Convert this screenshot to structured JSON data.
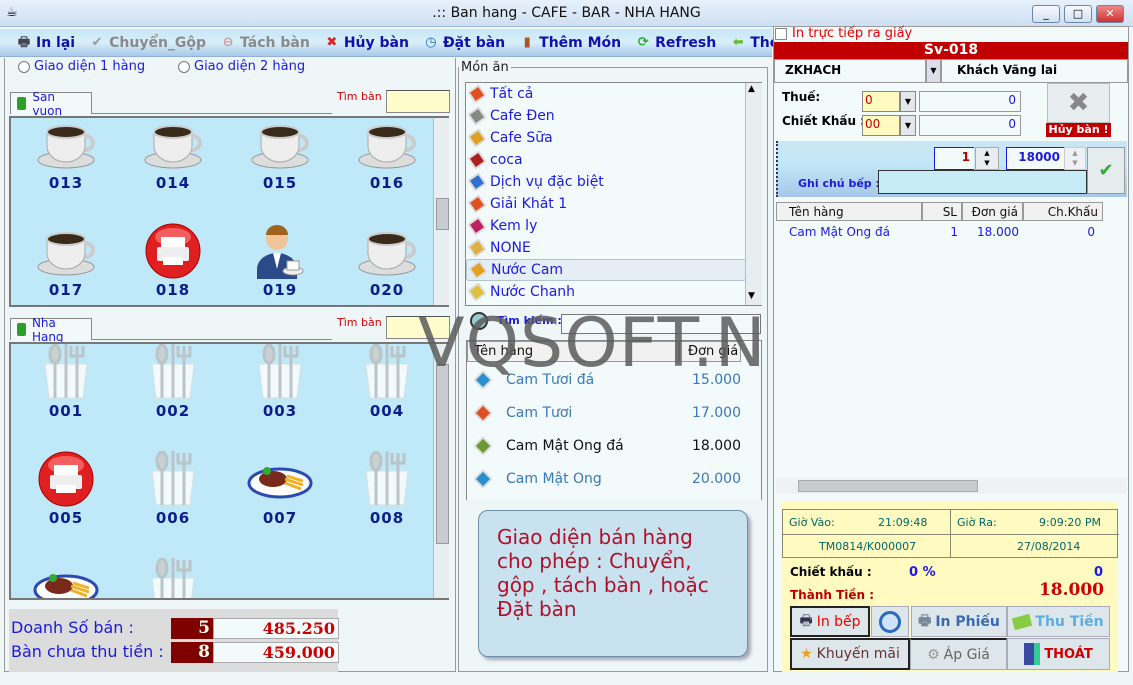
{
  "window": {
    "title": ".:: Ban hang - CAFE - BAR - NHA HANG",
    "min": "_",
    "max": "□",
    "close": "✕"
  },
  "toolbar": [
    {
      "label": "In lại",
      "icon": "printer-icon",
      "enabled": true
    },
    {
      "label": "Chuyển_Gộp",
      "icon": "check-icon",
      "enabled": false
    },
    {
      "label": "Tách bàn",
      "icon": "minus-circle-icon",
      "enabled": false
    },
    {
      "label": "Hủy bàn",
      "icon": "x-icon",
      "enabled": true
    },
    {
      "label": "Đặt bàn",
      "icon": "clock-icon",
      "enabled": true
    },
    {
      "label": "Thêm Món",
      "icon": "door-icon",
      "enabled": true
    },
    {
      "label": "Refresh",
      "icon": "refresh-icon",
      "enabled": true
    },
    {
      "label": "Thoát",
      "icon": "arrow-left-icon",
      "enabled": true
    }
  ],
  "layout_options": {
    "one_row": "Giao diện 1 hàng",
    "two_rows": "Giao diện 2 hàng"
  },
  "areas": [
    {
      "name": "San vuon",
      "find_label": "Tìm bàn :",
      "tables": [
        {
          "no": "013",
          "status": "coffee"
        },
        {
          "no": "014",
          "status": "coffee"
        },
        {
          "no": "015",
          "status": "coffee"
        },
        {
          "no": "016",
          "status": "coffee"
        },
        {
          "no": "017",
          "status": "coffee"
        },
        {
          "no": "018",
          "status": "printed"
        },
        {
          "no": "019",
          "status": "waiter"
        },
        {
          "no": "020",
          "status": "coffee"
        }
      ]
    },
    {
      "name": "Nha Hang",
      "find_label": "Tìm bàn :",
      "tables": [
        {
          "no": "001",
          "status": "empty"
        },
        {
          "no": "002",
          "status": "empty"
        },
        {
          "no": "003",
          "status": "empty"
        },
        {
          "no": "004",
          "status": "empty"
        },
        {
          "no": "005",
          "status": "printed"
        },
        {
          "no": "006",
          "status": "empty"
        },
        {
          "no": "007",
          "status": "dish"
        },
        {
          "no": "008",
          "status": "empty"
        },
        {
          "no": "",
          "status": "dish"
        },
        {
          "no": "",
          "status": "empty"
        }
      ]
    }
  ],
  "summary": {
    "sales_label": "Doanh Số bán :",
    "sales_count": "5",
    "sales_amount": "485.250",
    "unpaid_label": "Bàn chưa thu tiền :",
    "unpaid_count": "8",
    "unpaid_amount": "459.000"
  },
  "menu": {
    "legend": "Món ăn",
    "categories": [
      {
        "label": "Tất cả",
        "color": "#e05020"
      },
      {
        "label": "Cafe Đen",
        "color": "#888888"
      },
      {
        "label": "Cafe Sữa",
        "color": "#e0a020"
      },
      {
        "label": "coca",
        "color": "#b02020"
      },
      {
        "label": "Dịch vụ đặc biệt",
        "color": "#3070d0"
      },
      {
        "label": "Giải Khát 1",
        "color": "#e05020"
      },
      {
        "label": "Kem ly",
        "color": "#c02060"
      },
      {
        "label": "NONE",
        "color": "#e0b040"
      },
      {
        "label": "Nước Cam",
        "color": "#e0a020"
      },
      {
        "label": "Nước Chanh",
        "color": "#e0c040"
      }
    ],
    "selected": "Nước Cam",
    "search_label": "Tìm kiếm :",
    "columns": [
      "Tên hàng",
      "Đơn giá"
    ],
    "products": [
      {
        "name": "Cam Tươi đá",
        "price": "15.000",
        "color": "#2a90d0"
      },
      {
        "name": "Cam Tươi",
        "price": "17.000",
        "color": "#e05020"
      },
      {
        "name": "Cam Mật Ong đá",
        "price": "18.000",
        "color": "#6a9a30"
      },
      {
        "name": "Cam Mật Ong",
        "price": "20.000",
        "color": "#2a90d0"
      }
    ],
    "selected_product": "Cam Mật Ong đá"
  },
  "tooltip": "Giao diện bán hàng cho phép : Chuyển, gộp , tách bàn , hoặc Đặt bàn",
  "watermark": "VQSOFT.NET",
  "order": {
    "print_direct": "In trực tiếp ra giấy",
    "table": "Sv-018",
    "customer_code": "ZKHACH",
    "customer_name": "Khách Vãng lai",
    "tax_label": "Thuế:",
    "tax_select": "0",
    "tax_value": "0",
    "discount_label": "Chiết Khấu :",
    "discount_select": "00",
    "discount_value": "0",
    "cancel_label": "Hủy bàn !",
    "qty": "1",
    "price": "18000",
    "kitchen_note_label": "Ghi chú bếp :",
    "kitchen_note": "",
    "columns": [
      "Tên hàng",
      "SL",
      "Đơn giá",
      "Ch.Khấu"
    ],
    "items": [
      {
        "name": "Cam Mật Ong đá",
        "qty": "1",
        "price": "18.000",
        "discount": "0"
      }
    ],
    "time_in_label": "Giờ Vào:",
    "time_in": "21:09:48",
    "time_out_label": "Giờ Ra:",
    "time_out": "9:09:20 PM",
    "invoice": "TM0814/K000007",
    "date": "27/08/2014",
    "discount_total_label": "Chiết khấu :",
    "discount_pct": "0 %",
    "discount_total": "0",
    "total_label": "Thành Tiền :",
    "total": "18.000",
    "buttons": {
      "kitchen": "In bếp",
      "print": "In Phiếu",
      "pay": "Thu Tiền",
      "promo": "Khuyến mãi",
      "apply_price": "Áp Giá",
      "exit": "THOÁT"
    }
  }
}
